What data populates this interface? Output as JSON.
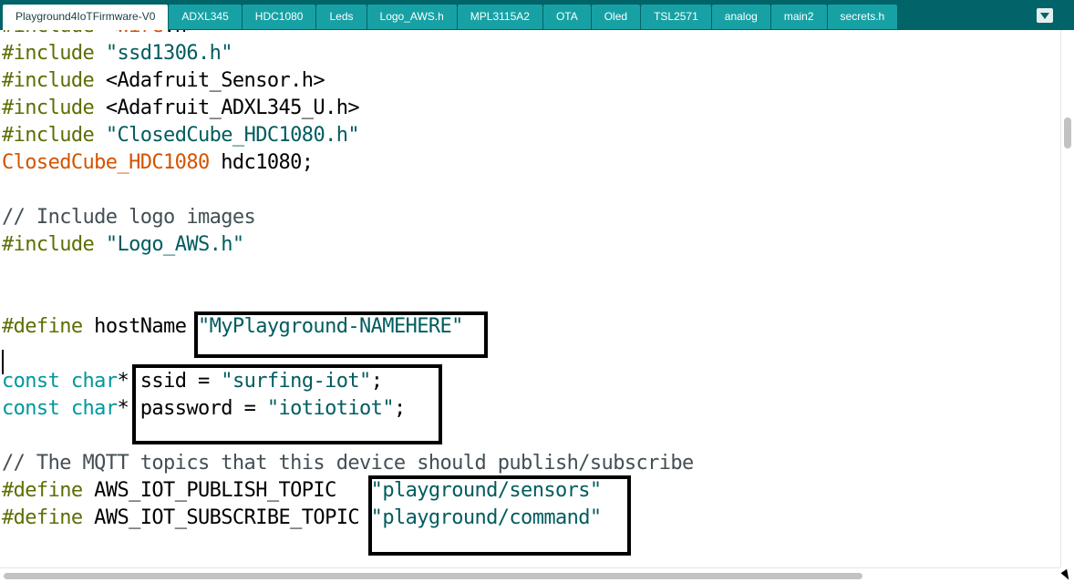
{
  "tabs": [
    {
      "label": "Playground4IoTFirmware-V0",
      "active": true
    },
    {
      "label": "ADXL345"
    },
    {
      "label": "HDC1080"
    },
    {
      "label": "Leds"
    },
    {
      "label": "Logo_AWS.h"
    },
    {
      "label": "MPL3115A2"
    },
    {
      "label": "OTA"
    },
    {
      "label": "Oled"
    },
    {
      "label": "TSL2571"
    },
    {
      "label": "analog"
    },
    {
      "label": "main2"
    },
    {
      "label": "secrets.h"
    }
  ],
  "tab_menu_icon": "dropdown-triangle-icon",
  "code_lines": [
    [
      {
        "t": "#include",
        "c": "kw"
      },
      {
        "t": " <"
      },
      {
        "t": "Wire",
        "c": "cls"
      },
      {
        "t": ".h>"
      }
    ],
    [
      {
        "t": "#include",
        "c": "kw"
      },
      {
        "t": " "
      },
      {
        "t": "\"ssd1306.h\"",
        "c": "str"
      }
    ],
    [
      {
        "t": "#include",
        "c": "kw"
      },
      {
        "t": " <Adafruit_Sensor.h>"
      }
    ],
    [
      {
        "t": "#include",
        "c": "kw"
      },
      {
        "t": " <Adafruit_ADXL345_U.h>"
      }
    ],
    [
      {
        "t": "#include",
        "c": "kw"
      },
      {
        "t": " "
      },
      {
        "t": "\"ClosedCube_HDC1080.h\"",
        "c": "str"
      }
    ],
    [
      {
        "t": "ClosedCube_HDC1080",
        "c": "cls"
      },
      {
        "t": " hdc1080;"
      }
    ],
    [],
    [
      {
        "t": "// Include logo images",
        "c": "cmt"
      }
    ],
    [
      {
        "t": "#include",
        "c": "kw"
      },
      {
        "t": " "
      },
      {
        "t": "\"Logo_AWS.h\"",
        "c": "str"
      }
    ],
    [],
    [],
    [
      {
        "t": "#define",
        "c": "kw"
      },
      {
        "t": " hostName "
      },
      {
        "t": "\"MyPlayground-NAMEHERE\"",
        "c": "str"
      }
    ],
    [],
    [
      {
        "t": "const",
        "c": "typ"
      },
      {
        "t": " "
      },
      {
        "t": "char",
        "c": "typ"
      },
      {
        "t": "* ssid = "
      },
      {
        "t": "\"surfing-iot\"",
        "c": "str"
      },
      {
        "t": ";"
      }
    ],
    [
      {
        "t": "const",
        "c": "typ"
      },
      {
        "t": " "
      },
      {
        "t": "char",
        "c": "typ"
      },
      {
        "t": "* password = "
      },
      {
        "t": "\"iotiotiot\"",
        "c": "str"
      },
      {
        "t": ";"
      }
    ],
    [],
    [
      {
        "t": "// The MQTT topics that this device should publish/subscribe",
        "c": "cmt"
      }
    ],
    [
      {
        "t": "#define",
        "c": "kw"
      },
      {
        "t": " AWS_IOT_PUBLISH_TOPIC   "
      },
      {
        "t": "\"playground/sensors\"",
        "c": "str"
      }
    ],
    [
      {
        "t": "#define",
        "c": "kw"
      },
      {
        "t": " AWS_IOT_SUBSCRIBE_TOPIC "
      },
      {
        "t": "\"playground/command\"",
        "c": "str"
      }
    ],
    [],
    []
  ]
}
